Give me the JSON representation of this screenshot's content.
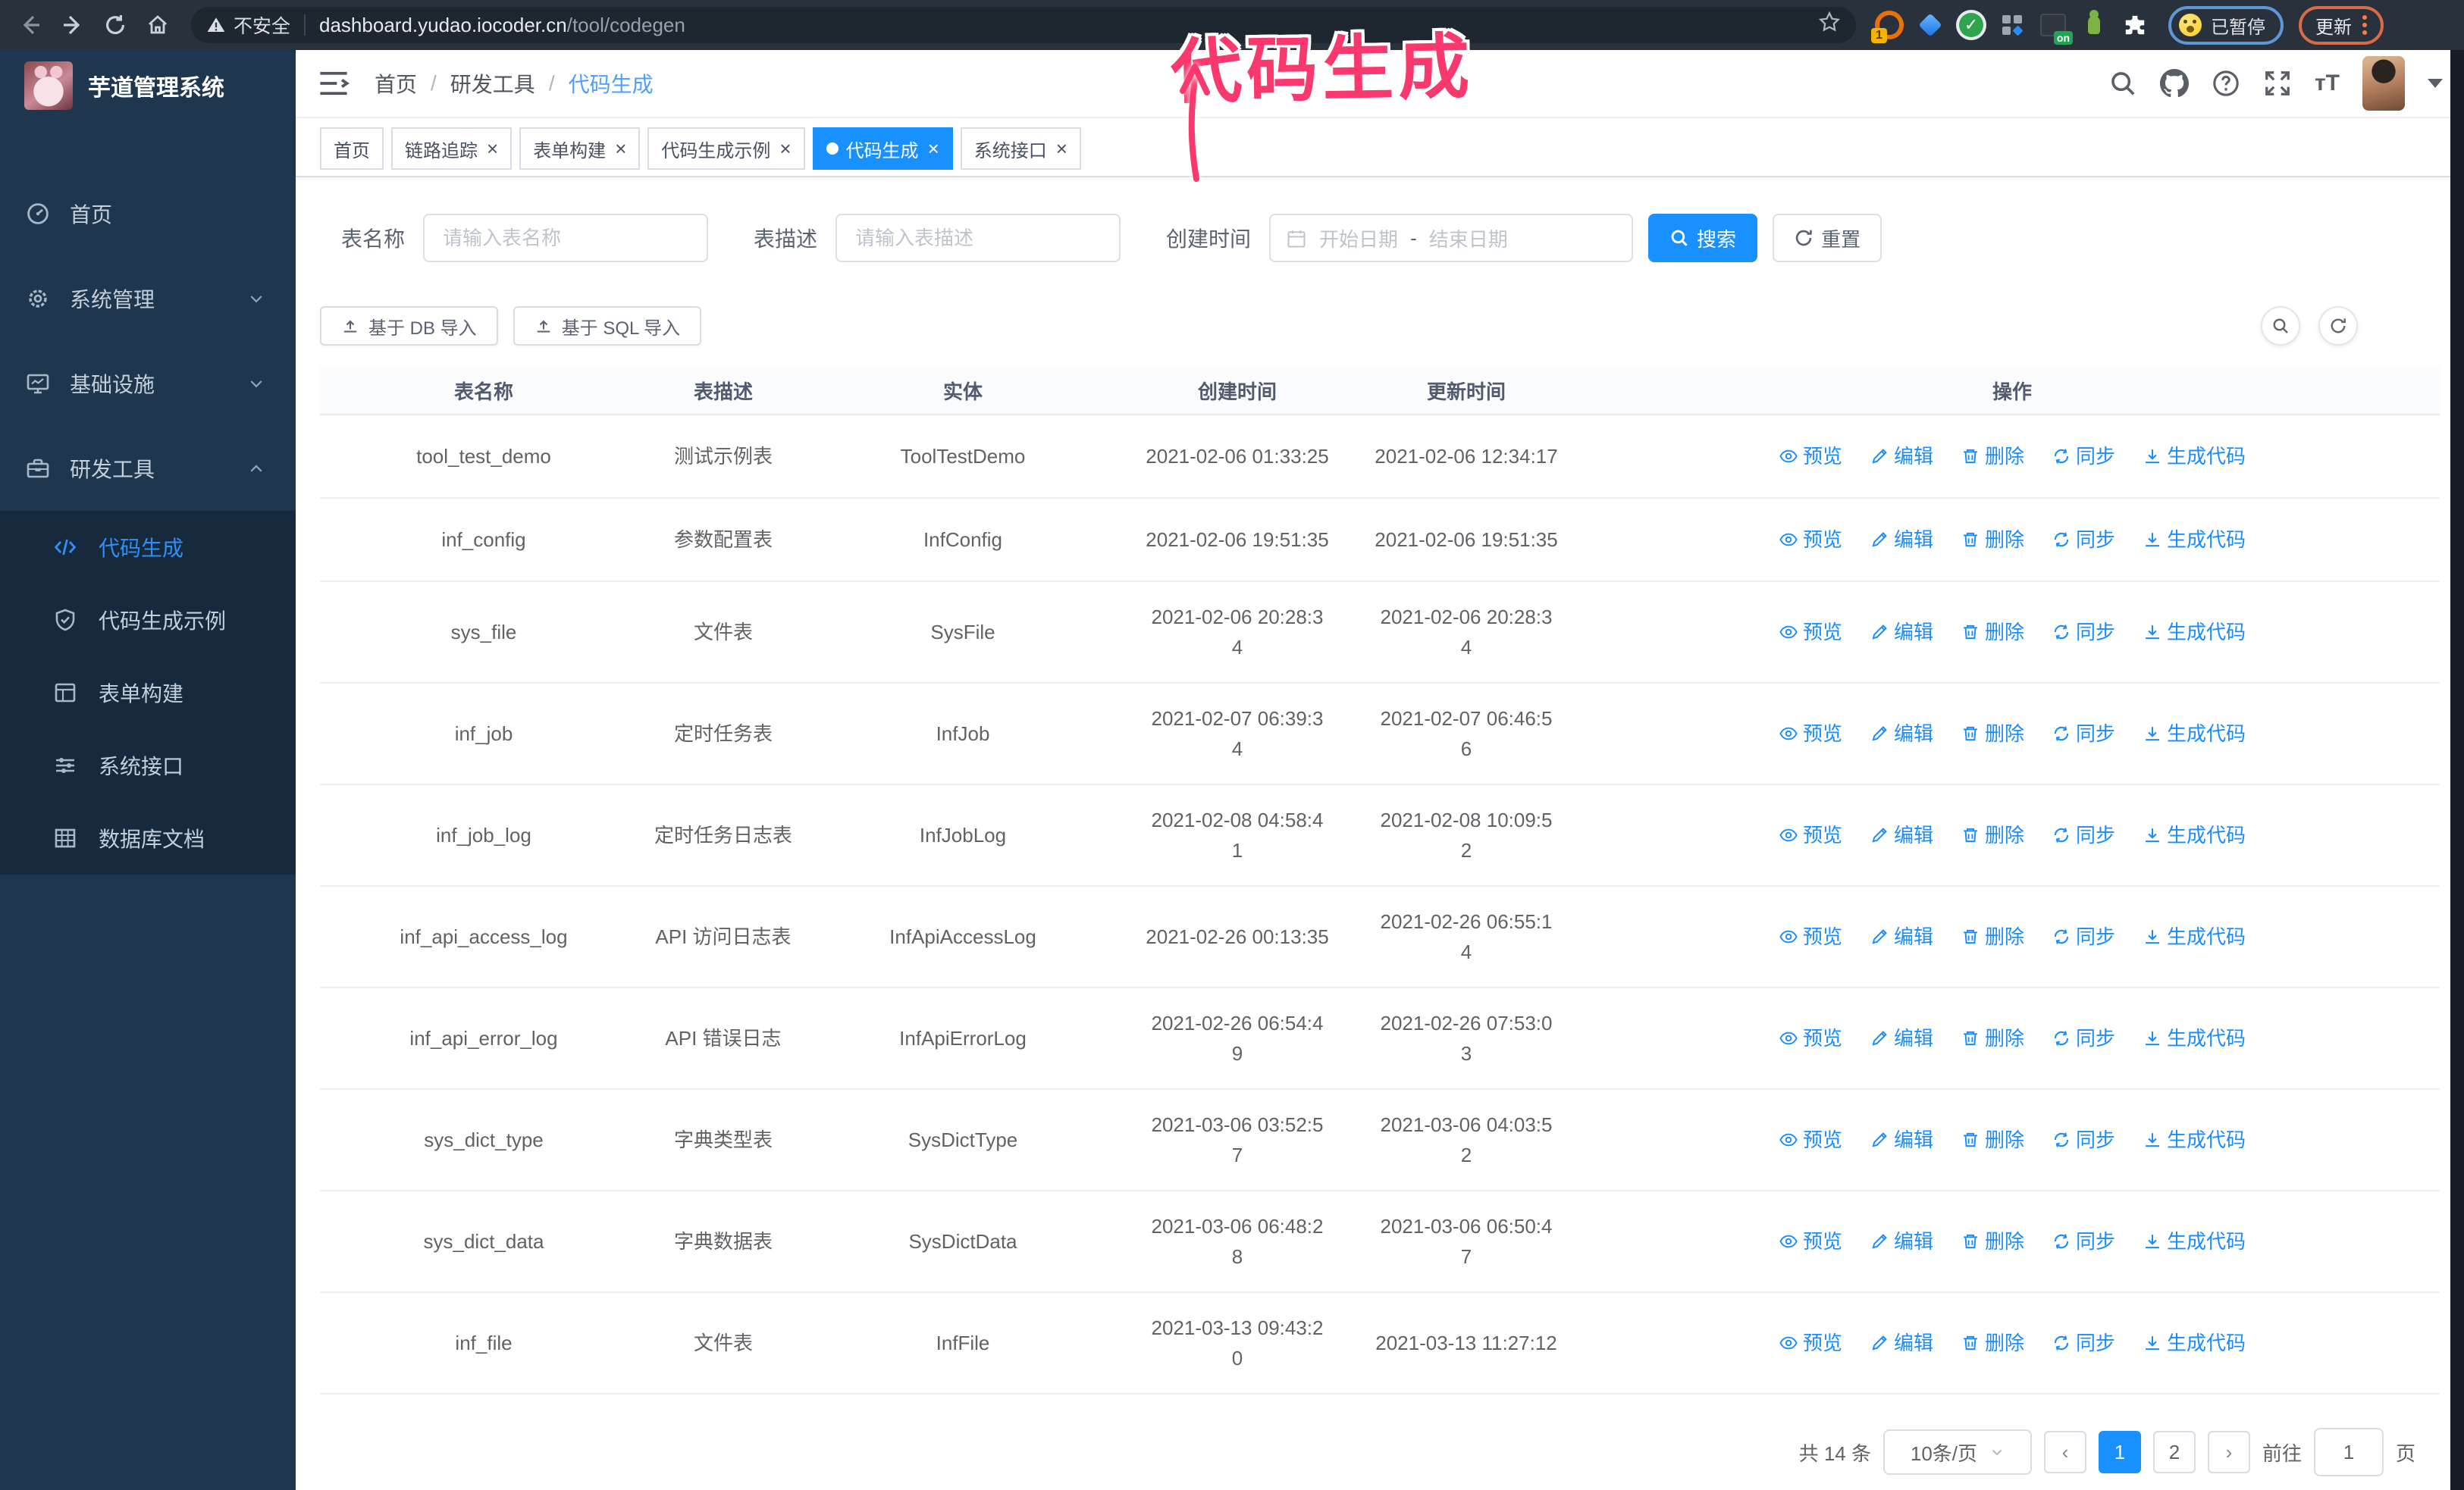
{
  "browser": {
    "not_secure": "不安全",
    "url_host": "dashboard.yudao.iocoder.cn",
    "url_path": "/tool/codegen",
    "ext_badge_1": "1",
    "ext_badge_on": "on",
    "paused_badge": "已暂停",
    "update_button": "更新"
  },
  "annotation": {
    "text": "代码生成"
  },
  "sidebar": {
    "logo_title": "芋道管理系统",
    "items": [
      {
        "id": "home",
        "icon": "dashboard-icon",
        "label": "首页"
      },
      {
        "id": "system",
        "icon": "gear-icon",
        "label": "系统管理",
        "chevron": "down"
      },
      {
        "id": "infra",
        "icon": "monitor-icon",
        "label": "基础设施",
        "chevron": "down"
      },
      {
        "id": "devtools",
        "icon": "toolbox-icon",
        "label": "研发工具",
        "chevron": "up",
        "children": [
          {
            "id": "codegen",
            "icon": "code-icon",
            "label": "代码生成",
            "active": true
          },
          {
            "id": "codegen-example",
            "icon": "shield-check-icon",
            "label": "代码生成示例"
          },
          {
            "id": "form-builder",
            "icon": "form-icon",
            "label": "表单构建"
          },
          {
            "id": "system-api",
            "icon": "sliders-icon",
            "label": "系统接口"
          },
          {
            "id": "db-doc",
            "icon": "table-icon",
            "label": "数据库文档"
          }
        ]
      }
    ]
  },
  "header": {
    "breadcrumb": [
      "首页",
      "研发工具",
      "代码生成"
    ],
    "separator": "/"
  },
  "tabs": [
    {
      "label": "首页",
      "closable": false
    },
    {
      "label": "链路追踪",
      "closable": true
    },
    {
      "label": "表单构建",
      "closable": true
    },
    {
      "label": "代码生成示例",
      "closable": true
    },
    {
      "label": "代码生成",
      "closable": true,
      "active": true
    },
    {
      "label": "系统接口",
      "closable": true
    }
  ],
  "filters": {
    "table_name_label": "表名称",
    "table_name_placeholder": "请输入表名称",
    "table_desc_label": "表描述",
    "table_desc_placeholder": "请输入表描述",
    "create_time_label": "创建时间",
    "date_start_placeholder": "开始日期",
    "date_separator": "-",
    "date_end_placeholder": "结束日期",
    "search_label": "搜索",
    "reset_label": "重置"
  },
  "toolbar": {
    "import_db_label": "基于 DB 导入",
    "import_sql_label": "基于 SQL 导入"
  },
  "table": {
    "columns": [
      "表名称",
      "表描述",
      "实体",
      "创建时间",
      "更新时间",
      "操作"
    ],
    "row_actions": [
      {
        "id": "preview",
        "label": "预览",
        "icon": "eye-icon"
      },
      {
        "id": "edit",
        "label": "编辑",
        "icon": "edit-icon"
      },
      {
        "id": "delete",
        "label": "删除",
        "icon": "delete-icon"
      },
      {
        "id": "sync",
        "label": "同步",
        "icon": "sync-icon"
      },
      {
        "id": "generate",
        "label": "生成代码",
        "icon": "download-icon"
      }
    ],
    "rows": [
      {
        "name": "tool_test_demo",
        "desc": "测试示例表",
        "entity": "ToolTestDemo",
        "created": "2021-02-06 01:33:25",
        "updated": "2021-02-06 12:34:17"
      },
      {
        "name": "inf_config",
        "desc": "参数配置表",
        "entity": "InfConfig",
        "created": "2021-02-06 19:51:35",
        "updated": "2021-02-06 19:51:35"
      },
      {
        "name": "sys_file",
        "desc": "文件表",
        "entity": "SysFile",
        "created": "2021-02-06 20:28:3\n4",
        "updated": "2021-02-06 20:28:3\n4"
      },
      {
        "name": "inf_job",
        "desc": "定时任务表",
        "entity": "InfJob",
        "created": "2021-02-07 06:39:3\n4",
        "updated": "2021-02-07 06:46:5\n6"
      },
      {
        "name": "inf_job_log",
        "desc": "定时任务日志表",
        "entity": "InfJobLog",
        "created": "2021-02-08 04:58:4\n1",
        "updated": "2021-02-08 10:09:5\n2"
      },
      {
        "name": "inf_api_access_log",
        "desc": "API 访问日志表",
        "entity": "InfApiAccessLog",
        "created": "2021-02-26 00:13:35",
        "updated": "2021-02-26 06:55:1\n4"
      },
      {
        "name": "inf_api_error_log",
        "desc": "API 错误日志",
        "entity": "InfApiErrorLog",
        "created": "2021-02-26 06:54:4\n9",
        "updated": "2021-02-26 07:53:0\n3"
      },
      {
        "name": "sys_dict_type",
        "desc": "字典类型表",
        "entity": "SysDictType",
        "created": "2021-03-06 03:52:5\n7",
        "updated": "2021-03-06 04:03:5\n2"
      },
      {
        "name": "sys_dict_data",
        "desc": "字典数据表",
        "entity": "SysDictData",
        "created": "2021-03-06 06:48:2\n8",
        "updated": "2021-03-06 06:50:4\n7"
      },
      {
        "name": "inf_file",
        "desc": "文件表",
        "entity": "InfFile",
        "created": "2021-03-13 09:43:2\n0",
        "updated": "2021-03-13 11:27:12"
      }
    ]
  },
  "pagination": {
    "total_label": "共 14 条",
    "page_size_label": "10条/页",
    "pages": [
      "1",
      "2"
    ],
    "active_page": "1",
    "goto_label": "前往",
    "goto_value": "1",
    "page_label": "页"
  },
  "colors": {
    "accent_blue": "#1890ff",
    "sidebar_bg": "#1f374e",
    "submenu_bg": "#17293d",
    "annotation_pink": "#f9386d"
  }
}
